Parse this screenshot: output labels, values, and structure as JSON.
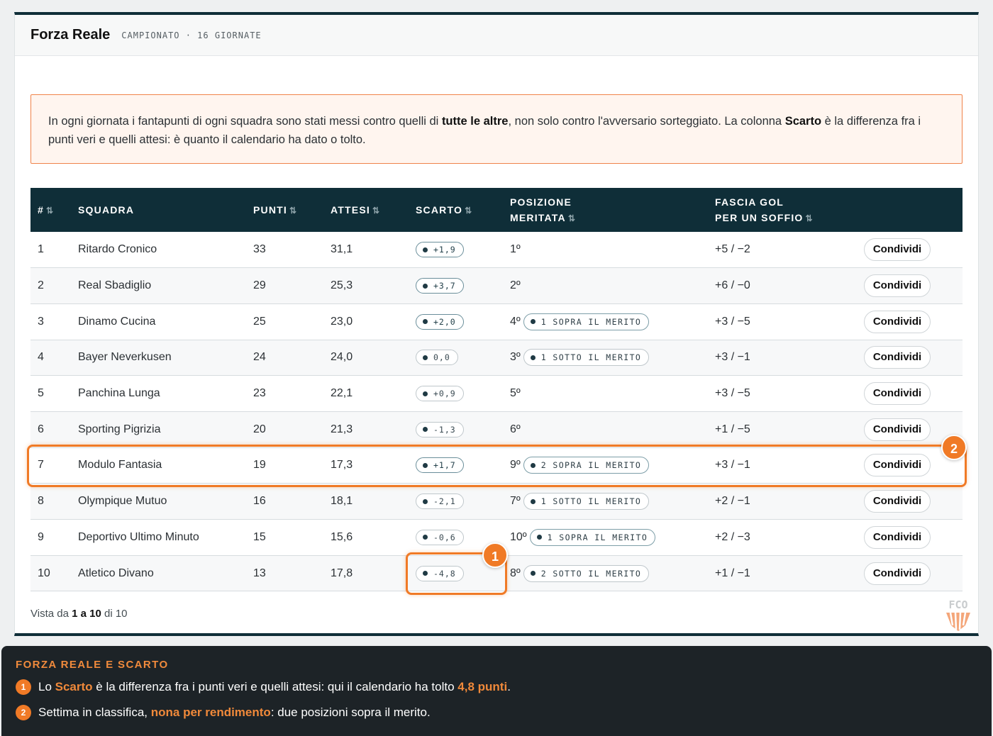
{
  "header": {
    "title": "Forza Reale",
    "subtitle": "CAMPIONATO · 16 GIORNATE"
  },
  "note": {
    "part1": "In ogni giornata i fantapunti di ogni squadra sono stati messi contro quelli di ",
    "bold1": "tutte le altre",
    "part2": ", non solo contro l'avversario sorteggiato. La colonna ",
    "bold2": "Scarto",
    "part3": " è la differenza fra i punti veri e quelli attesi: è quanto il calendario ha dato o tolto."
  },
  "columns": {
    "rank": "#",
    "team": "SQUADRA",
    "points": "PUNTI",
    "expected": "ATTESI",
    "diff": "SCARTO",
    "position_l1": "POSIZIONE",
    "position_l2": "MERITATA",
    "band_l1": "FASCIA GOL",
    "band_l2": "PER UN SOFFIO",
    "sort_icon": "⇅"
  },
  "rows": [
    {
      "rank": "1",
      "team": "Ritardo Cronico",
      "points": "33",
      "expected": "31,1",
      "diff": "+1,9",
      "diff_positive": true,
      "position": "1º",
      "badge": "",
      "band": "+5 / −2",
      "action": "Condividi"
    },
    {
      "rank": "2",
      "team": "Real Sbadiglio",
      "points": "29",
      "expected": "25,3",
      "diff": "+3,7",
      "diff_positive": true,
      "position": "2º",
      "badge": "",
      "band": "+6 / −0",
      "action": "Condividi"
    },
    {
      "rank": "3",
      "team": "Dinamo Cucina",
      "points": "25",
      "expected": "23,0",
      "diff": "+2,0",
      "diff_positive": true,
      "position": "4º",
      "badge": "1 SOPRA IL MERITO",
      "band": "+3 / −5",
      "action": "Condividi"
    },
    {
      "rank": "4",
      "team": "Bayer Neverkusen",
      "points": "24",
      "expected": "24,0",
      "diff": "0,0",
      "diff_positive": false,
      "position": "3º",
      "badge": "1 SOTTO IL MERITO",
      "band": "+3 / −1",
      "action": "Condividi"
    },
    {
      "rank": "5",
      "team": "Panchina Lunga",
      "points": "23",
      "expected": "22,1",
      "diff": "+0,9",
      "diff_positive": false,
      "position": "5º",
      "badge": "",
      "band": "+3 / −5",
      "action": "Condividi"
    },
    {
      "rank": "6",
      "team": "Sporting Pigrizia",
      "points": "20",
      "expected": "21,3",
      "diff": "-1,3",
      "diff_positive": false,
      "position": "6º",
      "badge": "",
      "band": "+1 / −5",
      "action": "Condividi"
    },
    {
      "rank": "7",
      "team": "Modulo Fantasia",
      "points": "19",
      "expected": "17,3",
      "diff": "+1,7",
      "diff_positive": true,
      "position": "9º",
      "badge": "2 SOPRA IL MERITO",
      "band": "+3 / −1",
      "action": "Condividi"
    },
    {
      "rank": "8",
      "team": "Olympique Mutuo",
      "points": "16",
      "expected": "18,1",
      "diff": "-2,1",
      "diff_positive": false,
      "position": "7º",
      "badge": "1 SOTTO IL MERITO",
      "band": "+2 / −1",
      "action": "Condividi"
    },
    {
      "rank": "9",
      "team": "Deportivo Ultimo Minuto",
      "points": "15",
      "expected": "15,6",
      "diff": "-0,6",
      "diff_positive": false,
      "position": "10º",
      "badge": "1 SOPRA IL MERITO",
      "band": "+2 / −3",
      "action": "Condividi"
    },
    {
      "rank": "10",
      "team": "Atletico Divano",
      "points": "13",
      "expected": "17,8",
      "diff": "-4,8",
      "diff_positive": false,
      "position": "8º",
      "badge": "2 SOTTO IL MERITO",
      "band": "+1 / −1",
      "action": "Condividi"
    }
  ],
  "footer": {
    "prefix": "Vista da ",
    "range": "1 a 10",
    "suffix": " di 10"
  },
  "logo": {
    "text": "FCO"
  },
  "highlights": {
    "one": "1",
    "two": "2"
  },
  "explain": {
    "title": "FORZA REALE E SCARTO",
    "items": [
      {
        "num": "1",
        "a": "Lo ",
        "accent1": "Scarto",
        "b": " è la differenza fra i punti veri e quelli attesi: qui il calendario ha tolto ",
        "accent2": "4,8 punti",
        "c": "."
      },
      {
        "num": "2",
        "a": "Settima in classifica, ",
        "accent1": "nona per rendimento",
        "b": ": due posizioni sopra il merito."
      }
    ]
  },
  "colors": {
    "accent": "#f07a26",
    "header_bg": "#0f2e38",
    "note_border": "#f0834a"
  }
}
